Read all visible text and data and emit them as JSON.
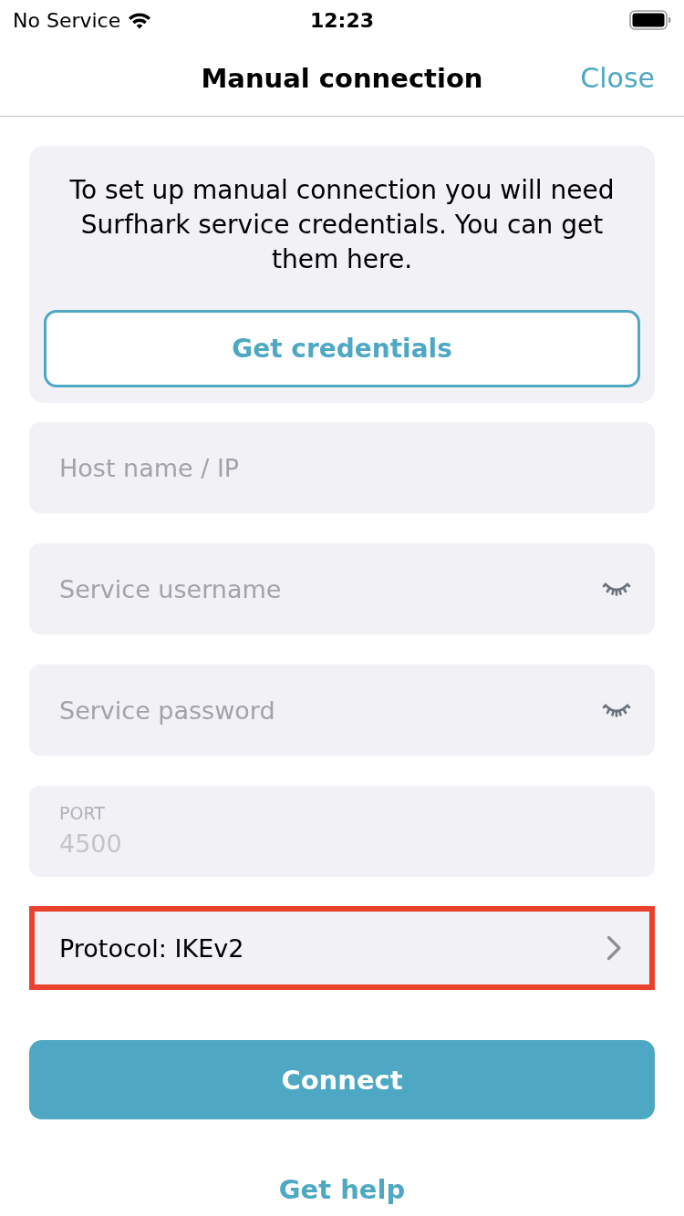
{
  "status_bar": {
    "carrier": "No Service",
    "time": "12:23"
  },
  "nav_bar": {
    "title": "Manual connection",
    "close": "Close"
  },
  "info_card": {
    "text": "To set up manual connection you will need Surfhark service credentials. You can get them here.",
    "button": "Get credentials"
  },
  "fields": [
    {
      "kind": "plain",
      "placeholder": "Host name / IP",
      "disabled": false
    },
    {
      "kind": "secret",
      "placeholder": "Service username",
      "disabled": false
    },
    {
      "kind": "secret",
      "placeholder": "Service password",
      "disabled": false
    },
    {
      "kind": "labeled",
      "label": "PORT",
      "value": "4500",
      "disabled": true
    }
  ],
  "protocol_row": {
    "label": "Protocol: IKEv2",
    "highlighted": true
  },
  "connect_button": "Connect",
  "help_link": "Get help"
}
